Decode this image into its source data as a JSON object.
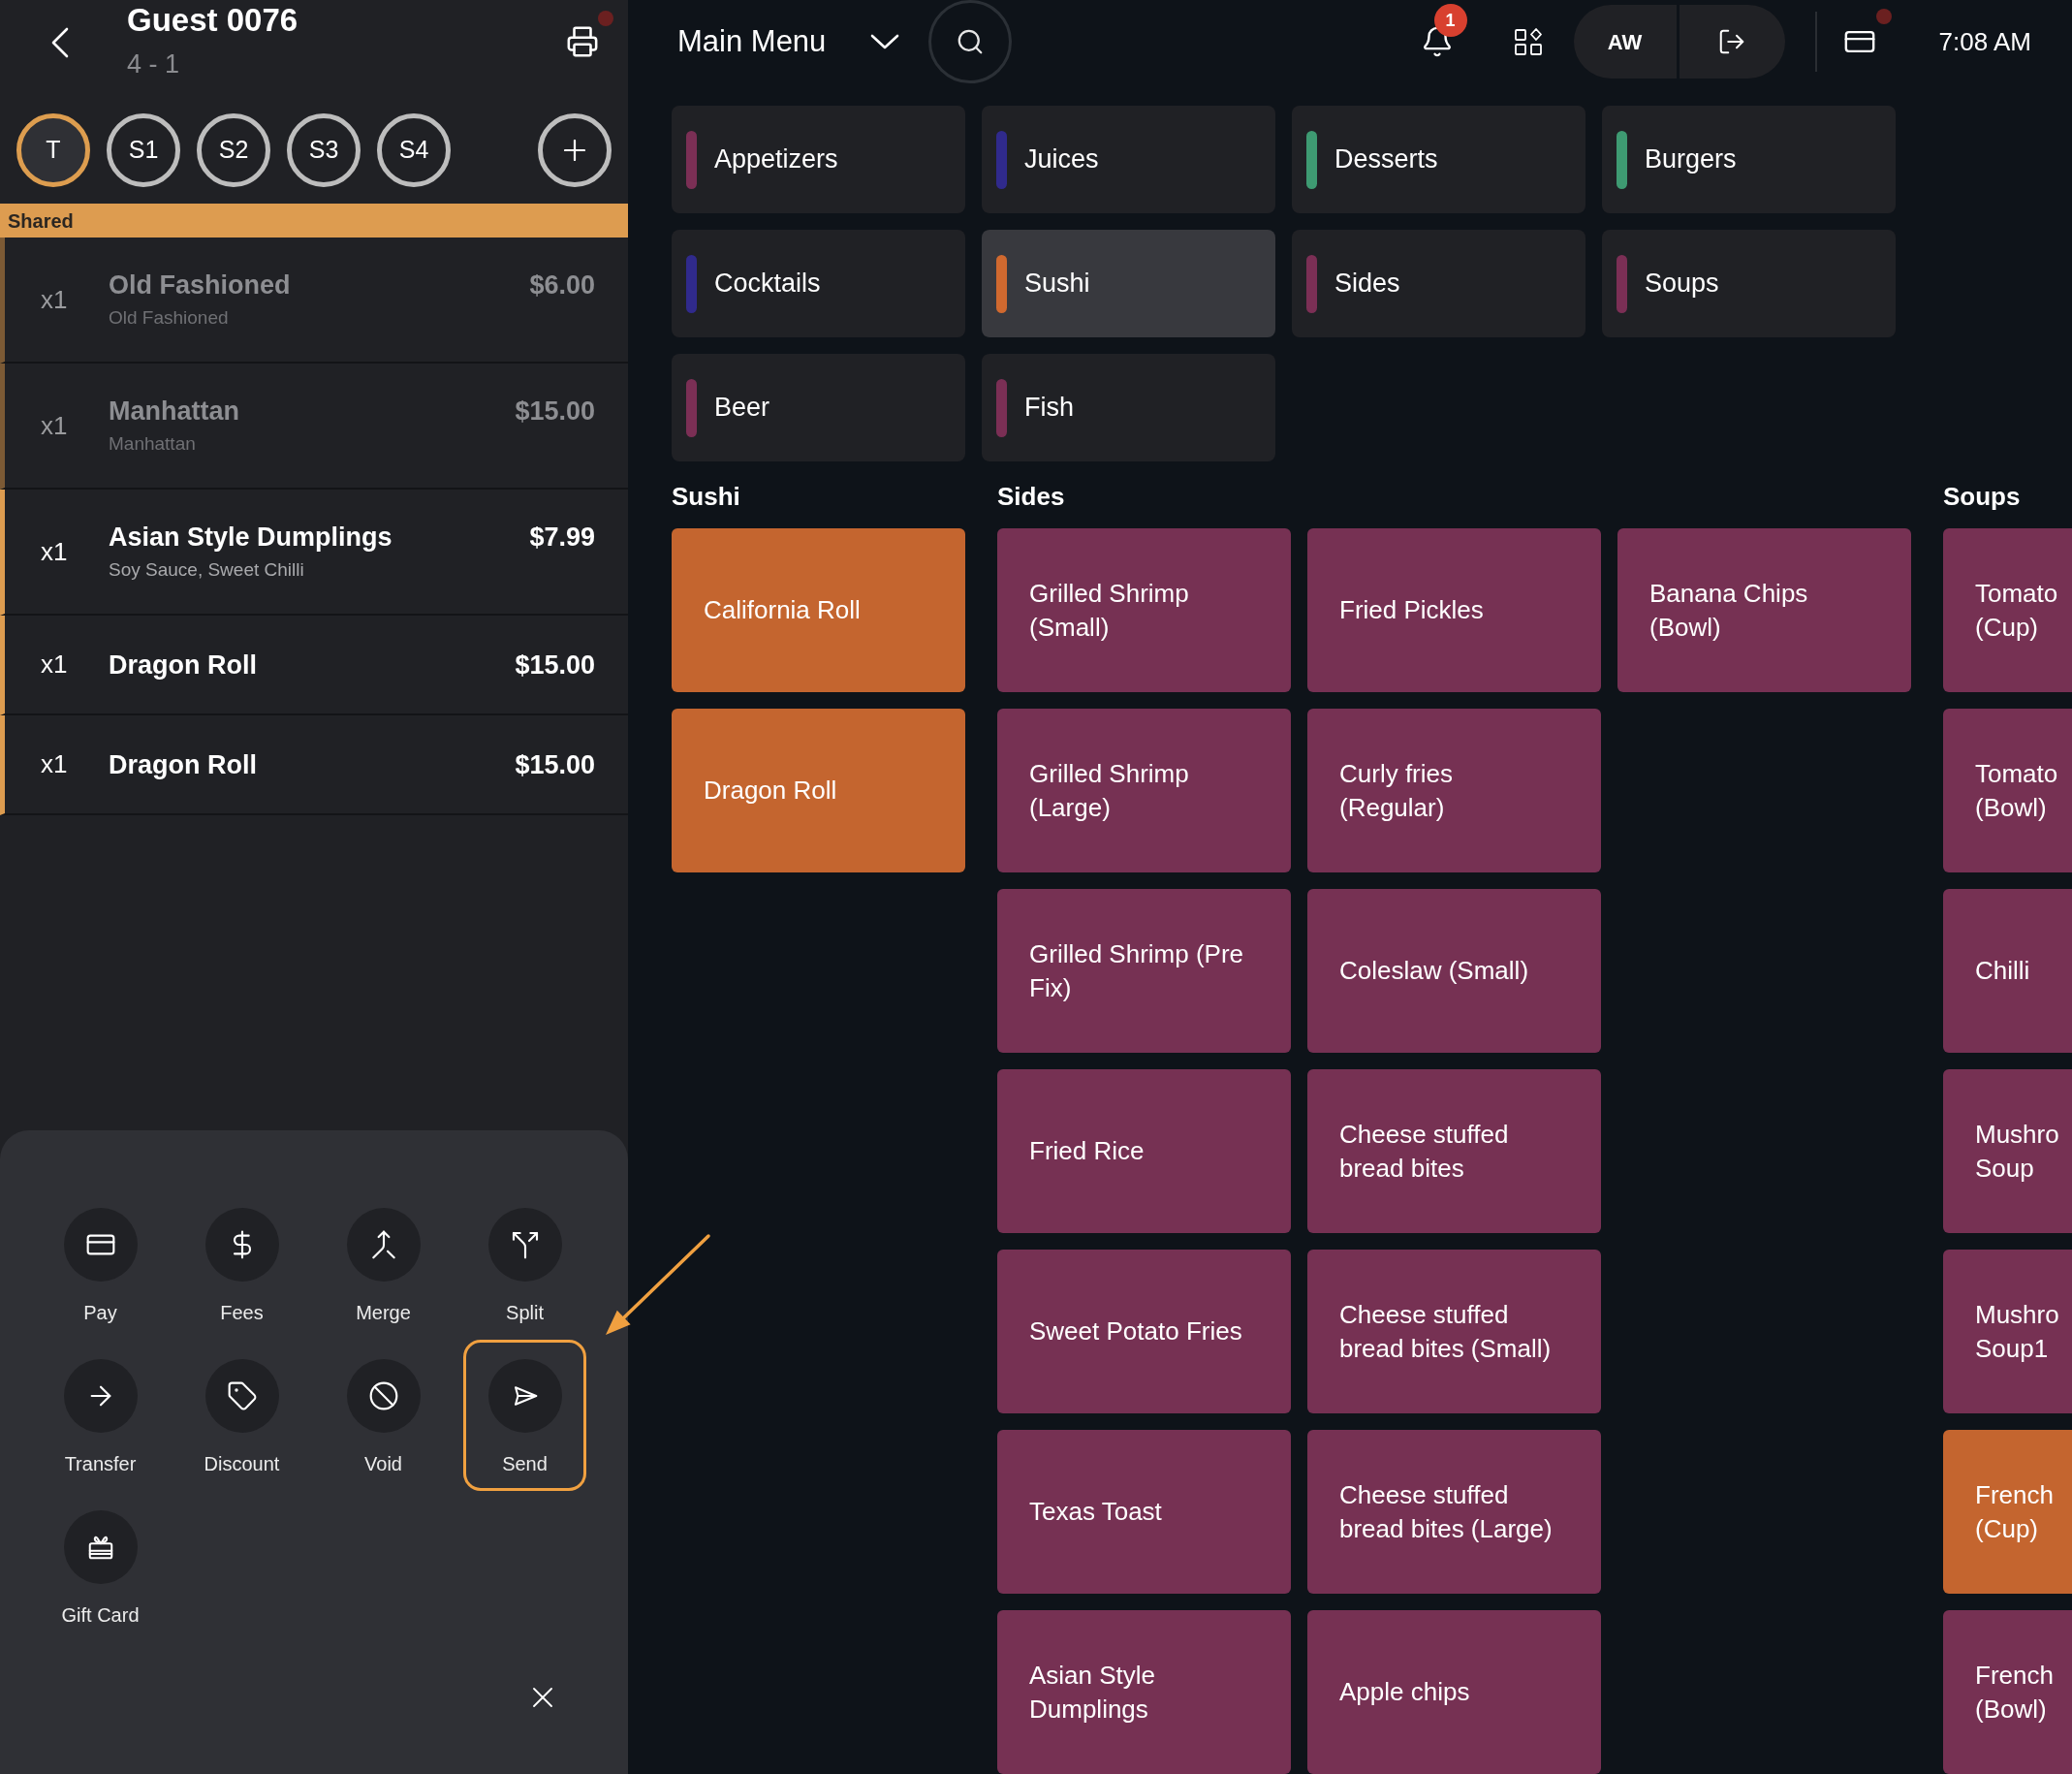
{
  "guest": {
    "title": "Guest 0076",
    "subtitle": "4 - 1",
    "printer_alert": true
  },
  "seats": [
    {
      "label": "T",
      "selected": true
    },
    {
      "label": "S1",
      "selected": false
    },
    {
      "label": "S2",
      "selected": false
    },
    {
      "label": "S3",
      "selected": false
    },
    {
      "label": "S4",
      "selected": false
    }
  ],
  "group_header": "Shared",
  "order_items": [
    {
      "quantity": "x1",
      "name": "Old Fashioned",
      "modifiers": "Old Fashioned",
      "price": "$6.00",
      "dimmed": true
    },
    {
      "quantity": "x1",
      "name": "Manhattan",
      "modifiers": "Manhattan",
      "price": "$15.00",
      "dimmed": true
    },
    {
      "quantity": "x1",
      "name": "Asian Style Dumplings",
      "modifiers": "Soy Sauce, Sweet Chilli",
      "price": "$7.99",
      "dimmed": false
    },
    {
      "quantity": "x1",
      "name": "Dragon Roll",
      "price": "$15.00",
      "dimmed": false
    },
    {
      "quantity": "x1",
      "name": "Dragon Roll",
      "price": "$15.00",
      "dimmed": false
    }
  ],
  "actions": [
    {
      "label": "Pay",
      "highlighted": false
    },
    {
      "label": "Fees",
      "highlighted": false
    },
    {
      "label": "Merge",
      "highlighted": false
    },
    {
      "label": "Split",
      "highlighted": false
    },
    {
      "label": "Transfer",
      "highlighted": false
    },
    {
      "label": "Discount",
      "highlighted": false
    },
    {
      "label": "Void",
      "highlighted": false
    },
    {
      "label": "Send",
      "highlighted": true
    },
    {
      "label": "Gift Card",
      "highlighted": false
    }
  ],
  "top_bar": {
    "menu_title": "Main Menu",
    "notification_count": "1",
    "user_initials": "AW",
    "card_alert": true,
    "time": "7:08 AM"
  },
  "categories": [
    {
      "label": "Appetizers",
      "color": "#7b2f55",
      "selected": false
    },
    {
      "label": "Juices",
      "color": "#302a8c",
      "selected": false
    },
    {
      "label": "Desserts",
      "color": "#3e9a72",
      "selected": false
    },
    {
      "label": "Burgers",
      "color": "#3e9a72",
      "selected": false
    },
    {
      "label": "Cocktails",
      "color": "#302a8c",
      "selected": false
    },
    {
      "label": "Sushi",
      "color": "#d0692f",
      "selected": true
    },
    {
      "label": "Sides",
      "color": "#7b2f55",
      "selected": false
    },
    {
      "label": "Soups",
      "color": "#7b2f55",
      "selected": false
    },
    {
      "label": "Beer",
      "color": "#7b2f55",
      "selected": false
    },
    {
      "label": "Fish",
      "color": "#7b2f55",
      "selected": false
    }
  ],
  "sections": [
    {
      "title": "Sushi",
      "columns": [
        [
          {
            "name": "California Roll",
            "color": "#c4652f"
          },
          {
            "name": "Dragon Roll",
            "color": "#c4652f"
          }
        ]
      ]
    },
    {
      "title": "Sides",
      "columns": [
        [
          {
            "name": "Grilled Shrimp\n(Small)",
            "color": "#763153"
          },
          {
            "name": "Grilled Shrimp\n(Large)",
            "color": "#763153"
          },
          {
            "name": "Grilled Shrimp (Pre\nFix)",
            "color": "#763153"
          },
          {
            "name": "Fried Rice",
            "color": "#763153"
          },
          {
            "name": "Sweet Potato Fries",
            "color": "#763153"
          },
          {
            "name": "Texas Toast",
            "color": "#763153"
          },
          {
            "name": "Asian Style\nDumplings",
            "color": "#763153"
          }
        ],
        [
          {
            "name": "Fried Pickles",
            "color": "#763153"
          },
          {
            "name": "Curly fries\n(Regular)",
            "color": "#763153"
          },
          {
            "name": "Coleslaw (Small)",
            "color": "#763153"
          },
          {
            "name": "Cheese stuffed\nbread bites",
            "color": "#763153"
          },
          {
            "name": "Cheese stuffed\nbread bites (Small)",
            "color": "#763153"
          },
          {
            "name": "Cheese stuffed\nbread bites (Large)",
            "color": "#763153"
          },
          {
            "name": "Apple chips",
            "color": "#763153"
          }
        ],
        [
          {
            "name": "Banana Chips\n(Bowl)",
            "color": "#763153"
          }
        ]
      ]
    },
    {
      "title": "Soups",
      "columns": [
        [
          {
            "name": "Tomato\n(Cup)",
            "color": "#763153"
          },
          {
            "name": "Tomato\n(Bowl)",
            "color": "#763153"
          },
          {
            "name": "Chilli",
            "color": "#763153"
          },
          {
            "name": "Mushro\nSoup",
            "color": "#763153"
          },
          {
            "name": "Mushro\nSoup1",
            "color": "#763153"
          },
          {
            "name": "French\n(Cup)",
            "color": "#c4652f"
          },
          {
            "name": "French\n(Bowl)",
            "color": "#763153"
          }
        ]
      ]
    }
  ]
}
